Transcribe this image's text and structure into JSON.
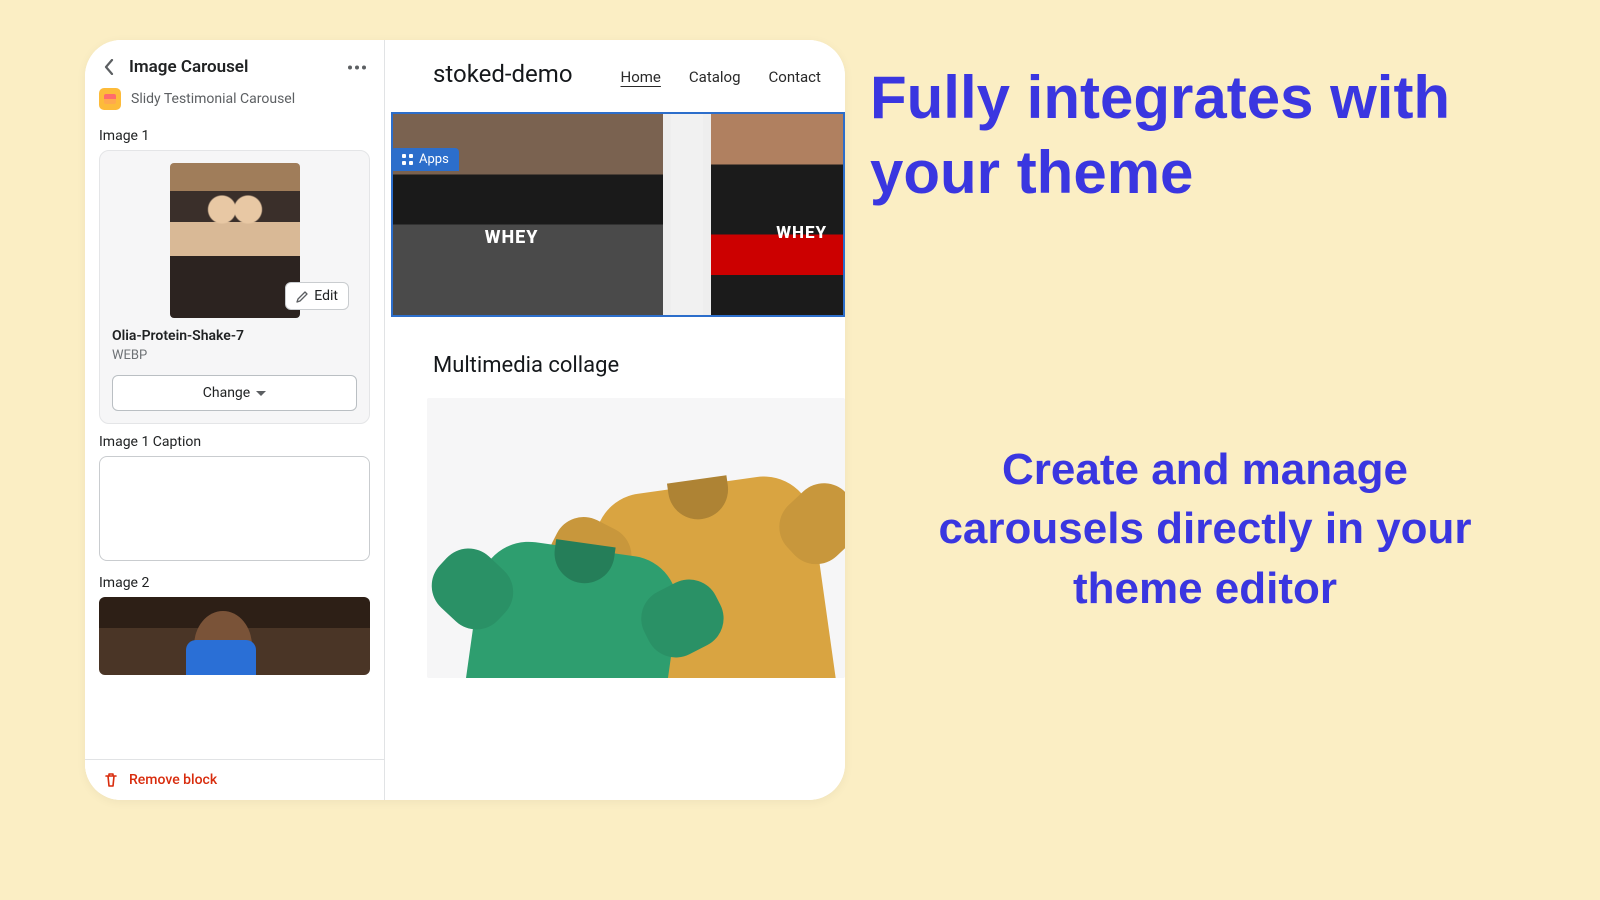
{
  "sidebar": {
    "title": "Image Carousel",
    "app_name": "Slidy Testimonial Carousel",
    "image1": {
      "label": "Image 1",
      "edit": "Edit",
      "filename": "Olia-Protein-Shake-7",
      "format": "WEBP",
      "change": "Change",
      "caption_label": "Image 1 Caption",
      "caption_value": ""
    },
    "image2": {
      "label": "Image 2"
    },
    "remove": "Remove block"
  },
  "preview": {
    "brand": "stoked-demo",
    "nav": {
      "home": "Home",
      "catalog": "Catalog",
      "contact": "Contact"
    },
    "apps_tag": "Apps",
    "collage_title": "Multimedia collage"
  },
  "marketing": {
    "headline": "Fully integrates with your theme",
    "sub": "Create and manage carousels directly in your theme editor"
  }
}
